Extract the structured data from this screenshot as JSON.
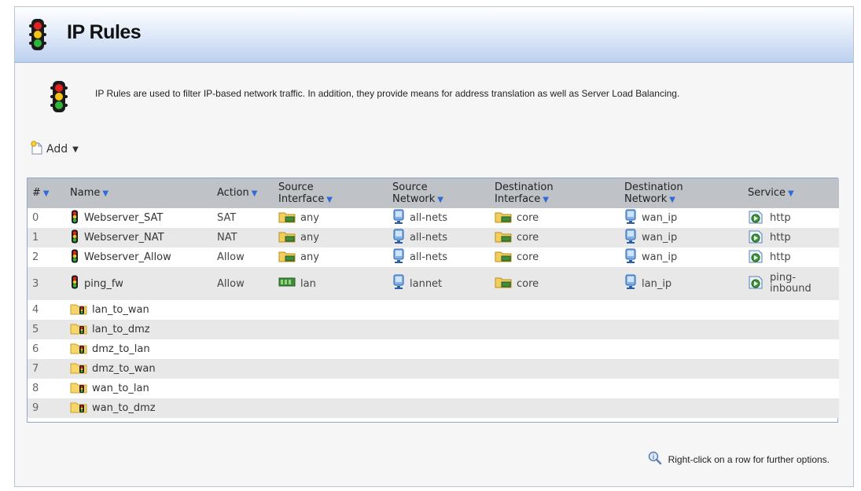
{
  "page": {
    "title": "IP Rules",
    "description": "IP Rules are used to filter IP-based network traffic. In addition, they provide means for address translation as well as Server Load Balancing.",
    "add_label": "Add",
    "hint": "Right-click on a row for further options."
  },
  "table": {
    "headers": {
      "num": "#",
      "name": "Name",
      "action": "Action",
      "src_if_1": "Source",
      "src_if_2": "Interface",
      "src_net_1": "Source",
      "src_net_2": "Network",
      "dst_if_1": "Destination",
      "dst_if_2": "Interface",
      "dst_net_1": "Destination",
      "dst_net_2": "Network",
      "service": "Service"
    },
    "rows": [
      {
        "num": "0",
        "name": "Webserver_SAT",
        "action": "SAT",
        "src_if": "any",
        "src_net": "all-nets",
        "dst_if": "core",
        "dst_net": "wan_ip",
        "service": "http"
      },
      {
        "num": "1",
        "name": "Webserver_NAT",
        "action": "NAT",
        "src_if": "any",
        "src_net": "all-nets",
        "dst_if": "core",
        "dst_net": "wan_ip",
        "service": "http"
      },
      {
        "num": "2",
        "name": "Webserver_Allow",
        "action": "Allow",
        "src_if": "any",
        "src_net": "all-nets",
        "dst_if": "core",
        "dst_net": "wan_ip",
        "service": "http"
      },
      {
        "num": "3",
        "name": "ping_fw",
        "action": "Allow",
        "src_if": "lan",
        "src_net": "lannet",
        "dst_if": "core",
        "dst_net": "lan_ip",
        "service": "ping-inbound"
      },
      {
        "num": "4",
        "name": "lan_to_wan"
      },
      {
        "num": "5",
        "name": "lan_to_dmz"
      },
      {
        "num": "6",
        "name": "dmz_to_lan"
      },
      {
        "num": "7",
        "name": "dmz_to_wan"
      },
      {
        "num": "8",
        "name": "wan_to_lan"
      },
      {
        "num": "9",
        "name": "wan_to_dmz"
      }
    ]
  },
  "icons": {
    "traffic_light": "traffic-light-icon",
    "folder_rule": "folder-traffic-light-icon",
    "interface": "interface-icon",
    "network": "network-address-icon",
    "service": "service-icon",
    "add": "add-document-icon",
    "info": "magnifier-info-icon"
  },
  "colors": {
    "title_gradient_bottom": "#bcd0ee",
    "header_bg": "#bfc2c6",
    "sort_arrow": "#2f6bd4",
    "row_alt": "#e8e8e8"
  }
}
